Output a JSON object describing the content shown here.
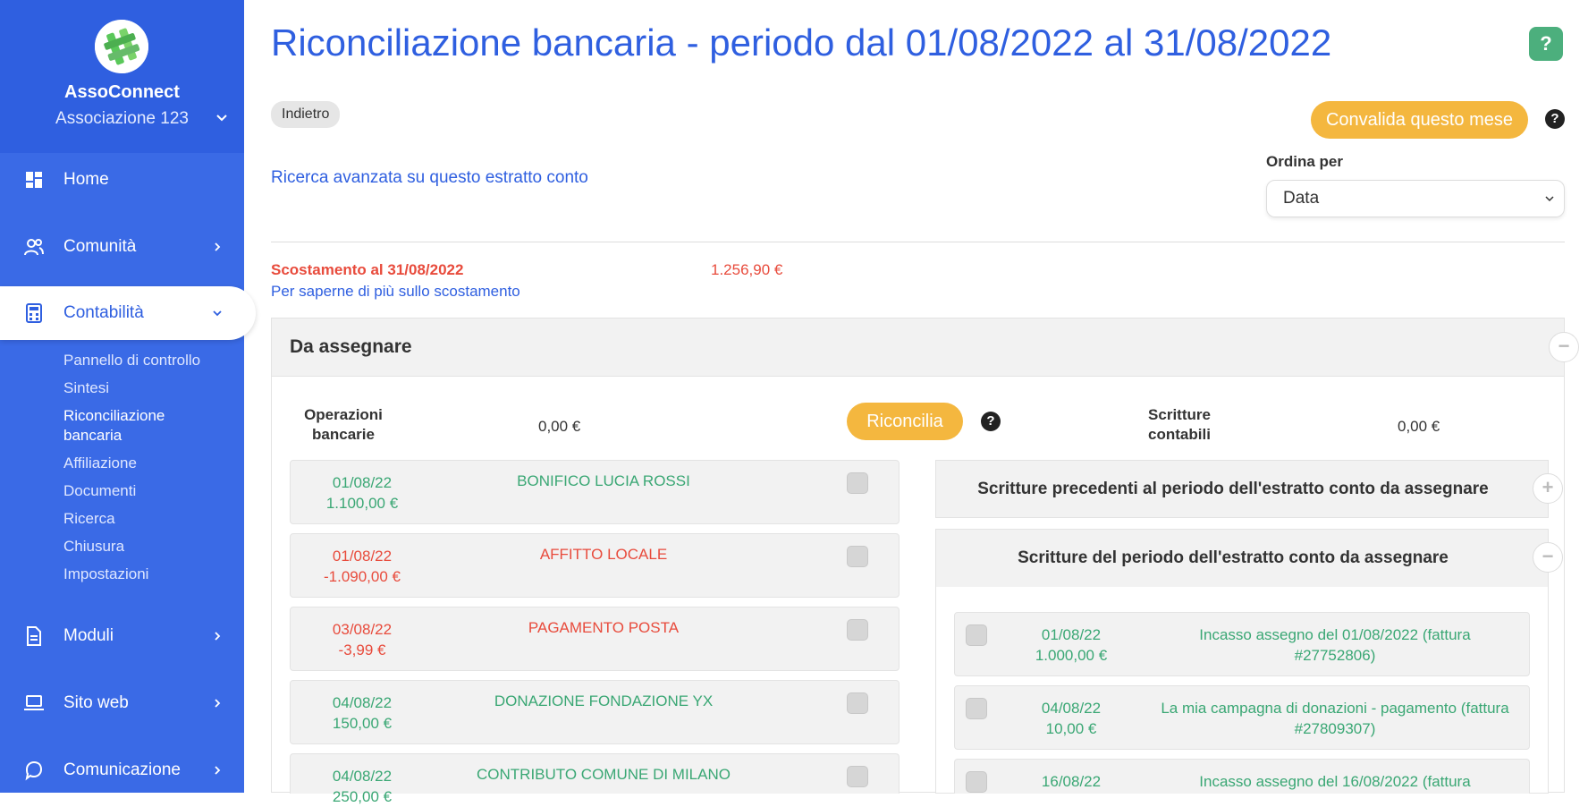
{
  "sidebar": {
    "org_name": "AssoConnect",
    "org_sub": "Associazione 123",
    "nav": [
      {
        "label": "Home"
      },
      {
        "label": "Comunità"
      },
      {
        "label": "Contabilità"
      },
      {
        "label": "Moduli"
      },
      {
        "label": "Sito web"
      },
      {
        "label": "Comunicazione"
      }
    ],
    "sub_items": [
      "Pannello di controllo",
      "Sintesi",
      "Riconciliazione\nbancaria",
      "Affiliazione",
      "Documenti",
      "Ricerca",
      "Chiusura",
      "Impostazioni"
    ]
  },
  "header": {
    "title": "Riconciliazione bancaria - periodo dal 01/08/2022 al 31/08/2022",
    "help": "?",
    "back_label": "Indietro",
    "validate_label": "Convalida questo mese",
    "advanced_search": "Ricerca avanzata su questo estratto conto",
    "sort_label": "Ordina per",
    "sort_value": "Data"
  },
  "gap": {
    "label": "Scostamento al 31/08/2022",
    "value": "1.256,90 €",
    "link": "Per saperne di più sullo scostamento"
  },
  "panel": {
    "title": "Da assegnare",
    "bank_col_title": "Operazioni bancarie",
    "bank_col_amount": "0,00 €",
    "reconcile_label": "Riconcilia",
    "acc_col_title": "Scritture contabili",
    "acc_col_amount": "0,00 €",
    "bank_rows": [
      {
        "date": "01/08/22",
        "amount": "1.100,00 €",
        "desc": "BONIFICO LUCIA ROSSI",
        "type": "in"
      },
      {
        "date": "01/08/22",
        "amount": "-1.090,00 €",
        "desc": "AFFITTO LOCALE",
        "type": "out"
      },
      {
        "date": "03/08/22",
        "amount": "-3,99 €",
        "desc": "PAGAMENTO POSTA",
        "type": "out"
      },
      {
        "date": "04/08/22",
        "amount": "150,00 €",
        "desc": "DONAZIONE FONDAZIONE YX",
        "type": "in"
      },
      {
        "date": "04/08/22",
        "amount": "250,00 €",
        "desc": "CONTRIBUTO COMUNE DI MILANO",
        "type": "in"
      }
    ],
    "acc_group_prev": "Scritture precedenti al periodo dell'estratto conto da assegnare",
    "acc_group_period": "Scritture del periodo dell'estratto conto da assegnare",
    "acc_rows": [
      {
        "date": "01/08/22",
        "amount": "1.000,00 €",
        "desc": "Incasso assegno del 01/08/2022 (fattura #27752806)"
      },
      {
        "date": "04/08/22",
        "amount": "10,00 €",
        "desc": "La mia campagna di donazioni - pagamento (fattura #27809307)"
      },
      {
        "date": "16/08/22",
        "amount": "",
        "desc": "Incasso assegno del 16/08/2022 (fattura"
      }
    ]
  },
  "colors": {
    "brand_blue": "#2f5fe0",
    "accent_yellow": "#f4b73f",
    "positive_green": "#3aa774",
    "negative_red": "#e84b3c"
  }
}
